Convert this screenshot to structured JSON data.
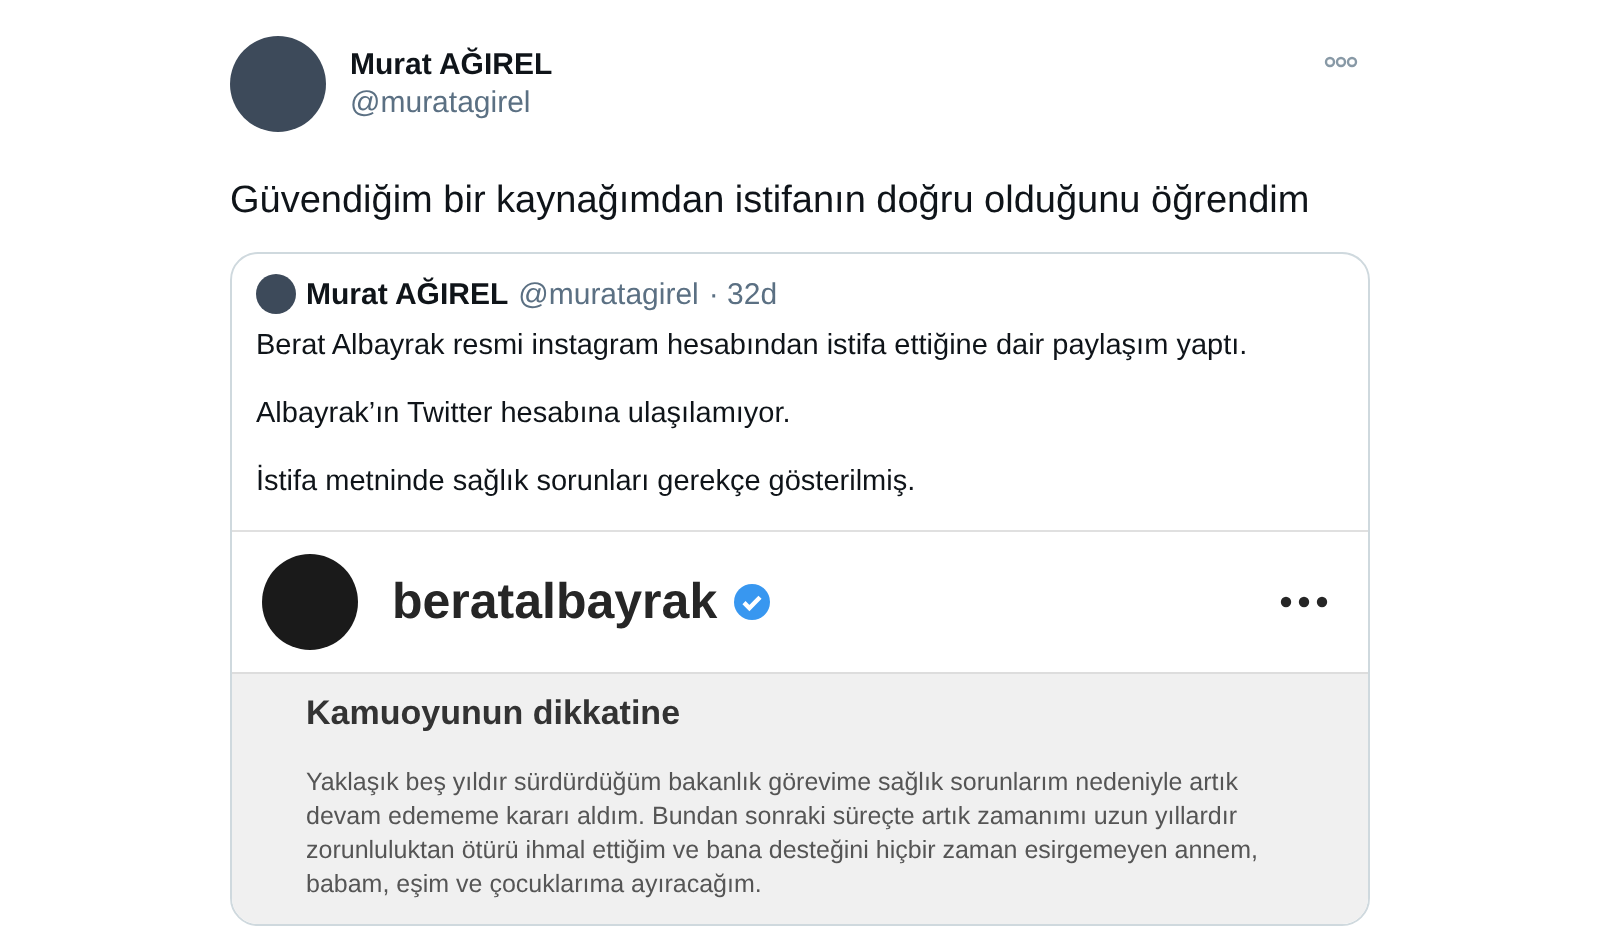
{
  "tweet": {
    "author": {
      "name": "Murat AĞIREL",
      "handle": "@muratagirel"
    },
    "text": "Güvendiğim bir kaynağımdan istifanın doğru olduğunu öğrendim",
    "quote": {
      "author": {
        "name": "Murat AĞIREL",
        "handle": "@muratagirel",
        "time": "· 32d"
      },
      "paragraphs": [
        "Berat Albayrak resmi instagram hesabından istifa ettiğine dair paylaşım yaptı.",
        "Albayrak’ın Twitter hesabına ulaşılamıyor.",
        "İstifa metninde sağlık sorunları gerekçe gösterilmiş."
      ],
      "image": {
        "username": "beratalbayrak",
        "verified": true,
        "heading": "Kamuoyunun dikkatine",
        "body": "Yaklaşık beş yıldır sürdürdüğüm bakanlık görevime sağlık sorunlarım nedeniyle artık devam edememe kararı aldım. Bundan sonraki süreçte artık zamanımı uzun yıllardır zorunluluktan ötürü ihmal ettiğim ve bana desteğini hiçbir zaman esirgemeyen annem, babam, eşim ve çocuklarıma ayıracağım."
      }
    }
  }
}
